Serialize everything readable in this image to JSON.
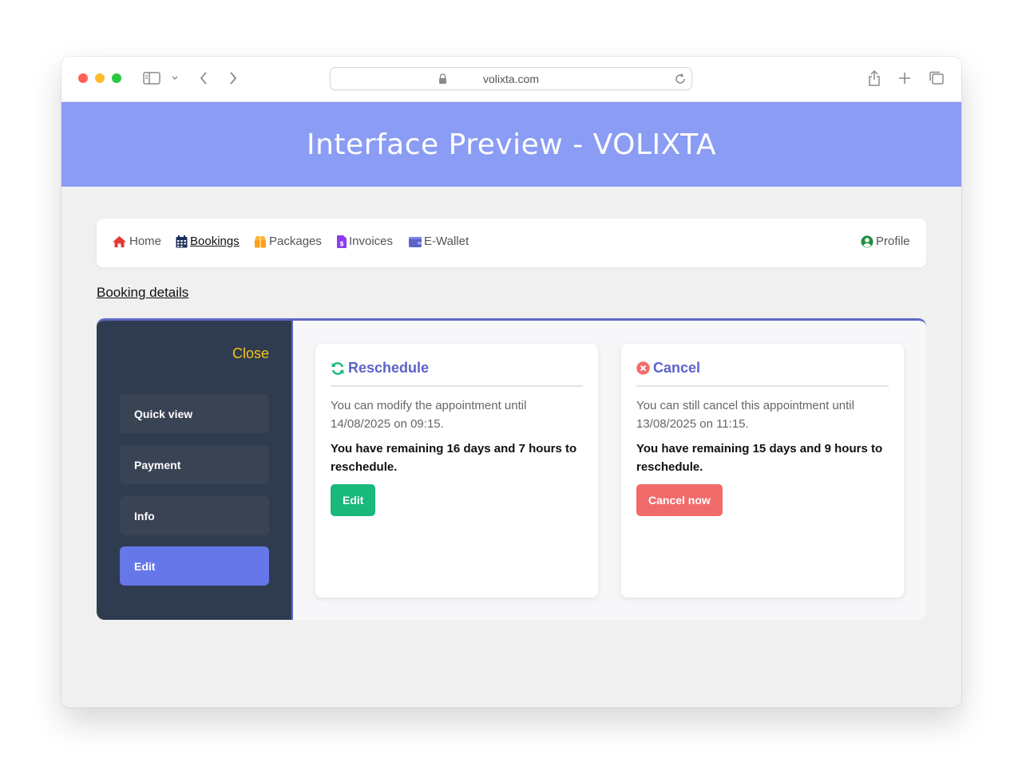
{
  "browser": {
    "url": "volixta.com"
  },
  "header": {
    "title": "Interface Preview - VOLIXTA"
  },
  "nav": {
    "items": [
      {
        "label": "Home",
        "icon": "home-icon",
        "color": "#e53935"
      },
      {
        "label": "Bookings",
        "icon": "calendar-icon",
        "color": "#1f2d5a",
        "active": true
      },
      {
        "label": "Packages",
        "icon": "package-icon",
        "color": "#ff9f1c"
      },
      {
        "label": "Invoices",
        "icon": "invoice-icon",
        "color": "#8b3cf0"
      },
      {
        "label": "E-Wallet",
        "icon": "wallet-icon",
        "color": "#5b63c7"
      }
    ],
    "profile_label": "Profile",
    "profile_icon": "user-circle-icon",
    "profile_color": "#1e8e3e"
  },
  "section": {
    "title": "Booking details"
  },
  "sidebar": {
    "close_label": "Close",
    "items": [
      {
        "label": "Quick view"
      },
      {
        "label": "Payment"
      },
      {
        "label": "Info"
      },
      {
        "label": "Edit",
        "active": true
      }
    ]
  },
  "reschedule": {
    "title": "Reschedule",
    "icon": "sync-icon",
    "description": "You can modify the appointment until 14/08/2025 on 09:15.",
    "remaining": "You have remaining 16 days and 7 hours to reschedule.",
    "button_label": "Edit"
  },
  "cancel": {
    "title": "Cancel",
    "icon": "cancel-circle-icon",
    "description": "You can still cancel this appointment until 13/08/2025 on 11:15.",
    "remaining": "You have remaining 15 days and 9 hours to reschedule.",
    "button_label": "Cancel now"
  },
  "colors": {
    "header_bg": "#8a9cf3",
    "sidebar_bg": "#2f3c50",
    "accent": "#5b63c7",
    "active_item": "#6577e9",
    "close_text": "#f5c518",
    "edit_button": "#19b87c",
    "cancel_button": "#f26b6b"
  }
}
